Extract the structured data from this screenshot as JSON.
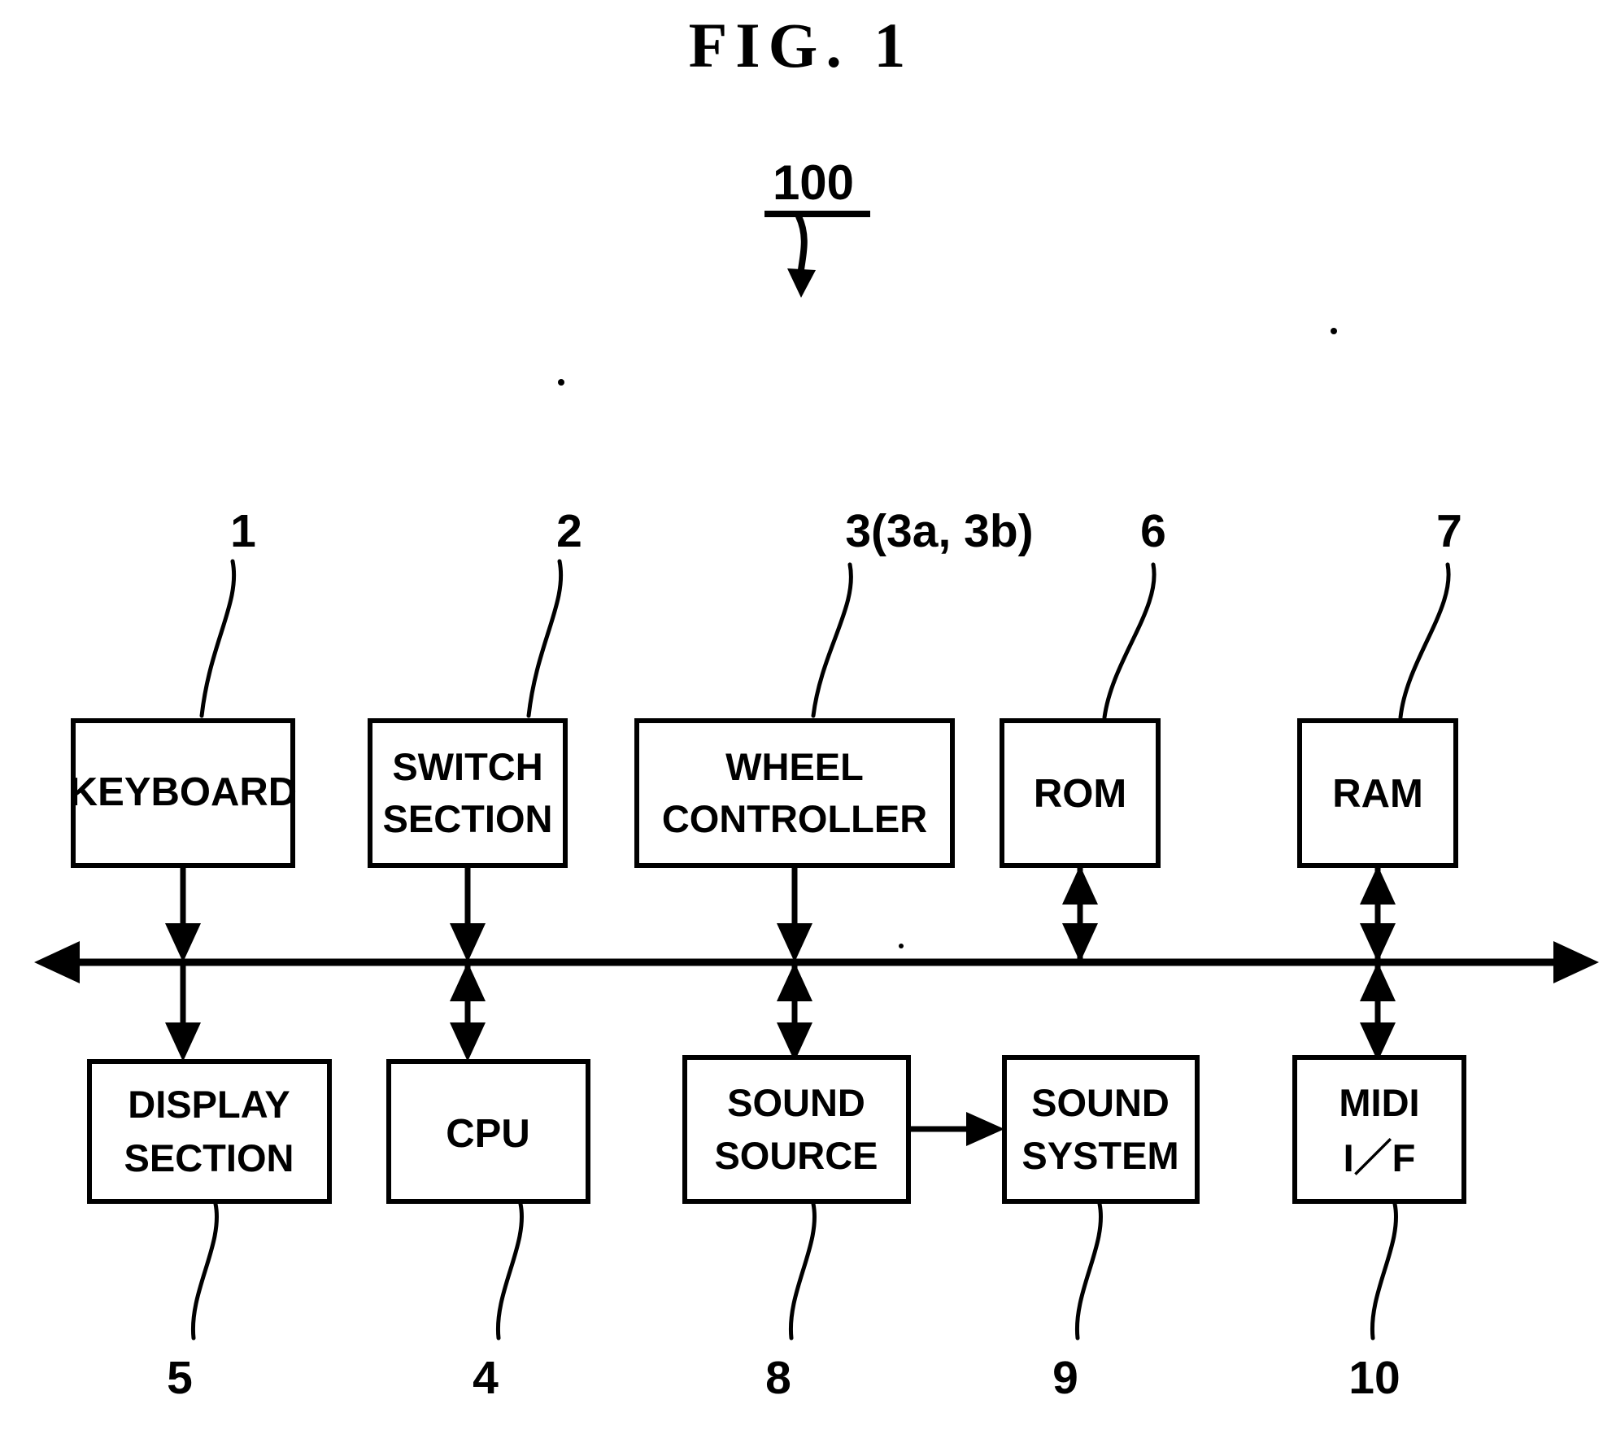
{
  "figure": {
    "title": "FIG. 1",
    "system_reference": "100"
  },
  "blocks": [
    {
      "id": "keyboard",
      "lines": [
        "KEYBOARD"
      ],
      "callout": "1",
      "callout_position": "top"
    },
    {
      "id": "switch",
      "lines": [
        "SWITCH",
        "SECTION"
      ],
      "callout": "2",
      "callout_position": "top"
    },
    {
      "id": "wheel",
      "lines": [
        "WHEEL",
        "CONTROLLER"
      ],
      "callout": "3(3a, 3b)",
      "callout_position": "top"
    },
    {
      "id": "rom",
      "lines": [
        "ROM"
      ],
      "callout": "6",
      "callout_position": "top"
    },
    {
      "id": "ram",
      "lines": [
        "RAM"
      ],
      "callout": "7",
      "callout_position": "top"
    },
    {
      "id": "display",
      "lines": [
        "DISPLAY",
        "SECTION"
      ],
      "callout": "5",
      "callout_position": "bottom"
    },
    {
      "id": "cpu",
      "lines": [
        "CPU"
      ],
      "callout": "4",
      "callout_position": "bottom"
    },
    {
      "id": "sound-source",
      "lines": [
        "SOUND",
        "SOURCE"
      ],
      "callout": "8",
      "callout_position": "bottom"
    },
    {
      "id": "sound-system",
      "lines": [
        "SOUND",
        "SYSTEM"
      ],
      "callout": "9",
      "callout_position": "bottom"
    },
    {
      "id": "midi",
      "lines": [
        "MIDI",
        "I／F"
      ],
      "callout": "10",
      "callout_position": "bottom"
    }
  ],
  "colors": {
    "ink": "#000000",
    "paper": "#ffffff"
  }
}
